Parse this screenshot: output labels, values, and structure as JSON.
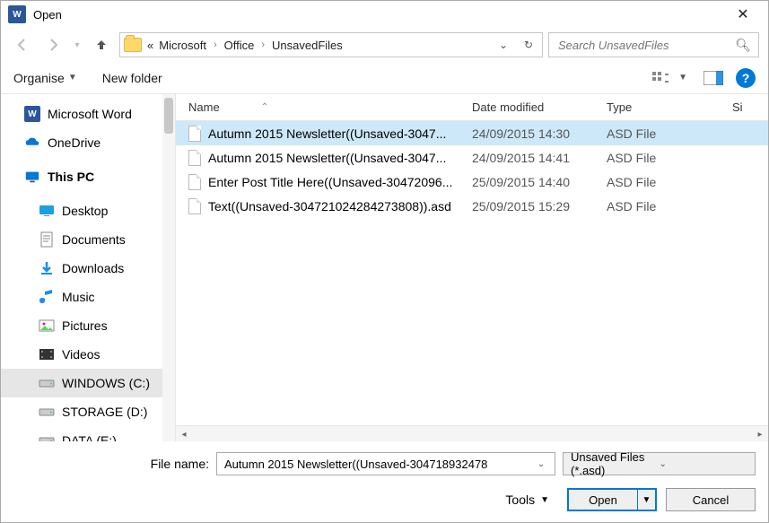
{
  "window": {
    "title": "Open"
  },
  "breadcrumbs": {
    "prefix": "«",
    "items": [
      "Microsoft",
      "Office",
      "UnsavedFiles"
    ]
  },
  "search": {
    "placeholder": "Search UnsavedFiles"
  },
  "toolbar": {
    "organise": "Organise",
    "new_folder": "New folder"
  },
  "sidebar": {
    "items": [
      {
        "label": "Microsoft Word",
        "icon": "word",
        "indent": false
      },
      {
        "label": "OneDrive",
        "icon": "onedrive",
        "indent": false
      },
      {
        "label": "This PC",
        "icon": "pc",
        "indent": false,
        "bold": true
      },
      {
        "label": "Desktop",
        "icon": "desktop",
        "indent": true
      },
      {
        "label": "Documents",
        "icon": "documents",
        "indent": true
      },
      {
        "label": "Downloads",
        "icon": "downloads",
        "indent": true
      },
      {
        "label": "Music",
        "icon": "music",
        "indent": true
      },
      {
        "label": "Pictures",
        "icon": "pictures",
        "indent": true
      },
      {
        "label": "Videos",
        "icon": "videos",
        "indent": true
      },
      {
        "label": "WINDOWS (C:)",
        "icon": "drive",
        "indent": true,
        "selected": true
      },
      {
        "label": "STORAGE (D:)",
        "icon": "drive",
        "indent": true
      },
      {
        "label": "DATA (E:)",
        "icon": "drive",
        "indent": true
      }
    ]
  },
  "columns": {
    "name": "Name",
    "date": "Date modified",
    "type": "Type",
    "size": "Si"
  },
  "files": [
    {
      "name": "Autumn 2015 Newsletter((Unsaved-3047...",
      "date": "24/09/2015 14:30",
      "type": "ASD File",
      "selected": true
    },
    {
      "name": "Autumn 2015 Newsletter((Unsaved-3047...",
      "date": "24/09/2015 14:41",
      "type": "ASD File",
      "selected": false
    },
    {
      "name": "Enter Post Title Here((Unsaved-30472096...",
      "date": "25/09/2015 14:40",
      "type": "ASD File",
      "selected": false
    },
    {
      "name": "Text((Unsaved-304721024284273808)).asd",
      "date": "25/09/2015 15:29",
      "type": "ASD File",
      "selected": false
    }
  ],
  "footer": {
    "filename_label": "File name:",
    "filename_value": "Autumn 2015 Newsletter((Unsaved-304718932478",
    "filter_label": "Unsaved Files (*.asd)",
    "tools": "Tools",
    "open": "Open",
    "cancel": "Cancel"
  }
}
